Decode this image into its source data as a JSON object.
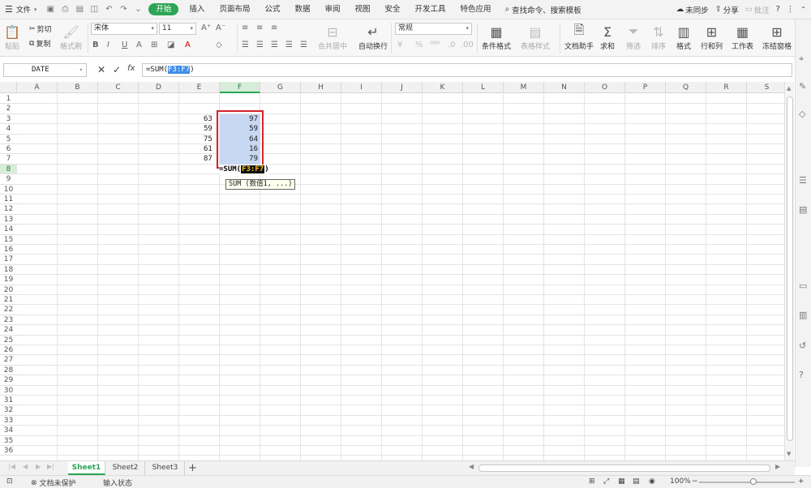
{
  "menubar": {
    "file_label": "文件",
    "tabs": [
      {
        "label": "开始",
        "active": true
      },
      {
        "label": "插入"
      },
      {
        "label": "页面布局"
      },
      {
        "label": "公式"
      },
      {
        "label": "数据"
      },
      {
        "label": "审阅"
      },
      {
        "label": "视图"
      },
      {
        "label": "安全"
      },
      {
        "label": "开发工具"
      },
      {
        "label": "特色应用"
      }
    ],
    "search_label": "查找命令、搜索模板",
    "sync_label": "未同步",
    "share_label": "分享",
    "comment_label": "批注"
  },
  "ribbon": {
    "paste": "粘贴",
    "cut": "剪切",
    "copy": "复制",
    "format_painter": "格式刷",
    "font_name": "宋体",
    "font_size": "11",
    "merge_center": "合并居中",
    "wrap_text": "自动换行",
    "number_format": "常规",
    "conditional_format": "条件格式",
    "table_style": "表格样式",
    "doc_helper": "文档助手",
    "sum": "求和",
    "filter": "筛选",
    "sort": "排序",
    "format": "格式",
    "row_col": "行和列",
    "worksheet": "工作表",
    "freeze": "冻结窗格"
  },
  "formulabar": {
    "namebox": "DATE",
    "formula_prefix": "=SUM(",
    "formula_ref": "F3:F7",
    "formula_suffix": ")"
  },
  "grid": {
    "columns": [
      "A",
      "B",
      "C",
      "D",
      "E",
      "F",
      "G",
      "H",
      "I",
      "J",
      "K",
      "L",
      "M",
      "N",
      "O",
      "P",
      "Q",
      "R",
      "S"
    ],
    "selected_column": "F",
    "selected_row": 8,
    "rows": [
      "1",
      "2",
      "3",
      "4",
      "5",
      "6",
      "7",
      "8",
      "9",
      "10",
      "11",
      "12",
      "13",
      "14",
      "15",
      "16",
      "17",
      "18",
      "19",
      "20",
      "21",
      "22",
      "23",
      "24",
      "25",
      "26",
      "27",
      "28",
      "29",
      "30",
      "31",
      "32",
      "33",
      "34",
      "35",
      "36"
    ],
    "e_values": [
      "63",
      "59",
      "75",
      "61",
      "87"
    ],
    "f_values": [
      "97",
      "59",
      "64",
      "16",
      "79"
    ],
    "edit_prefix": "=SUM(",
    "edit_ref": "F3:F7",
    "edit_suffix": ")",
    "tooltip": "SUM (数值1, ...)"
  },
  "sheets": {
    "tabs": [
      "Sheet1",
      "Sheet2",
      "Sheet3"
    ],
    "active": "Sheet1"
  },
  "status": {
    "protect": "文档未保护",
    "mode": "输入状态",
    "zoom": "100%"
  },
  "colors": {
    "accent": "#2ca556",
    "selection_border": "#d2232a",
    "selection_fill": "#c8d7f2"
  }
}
